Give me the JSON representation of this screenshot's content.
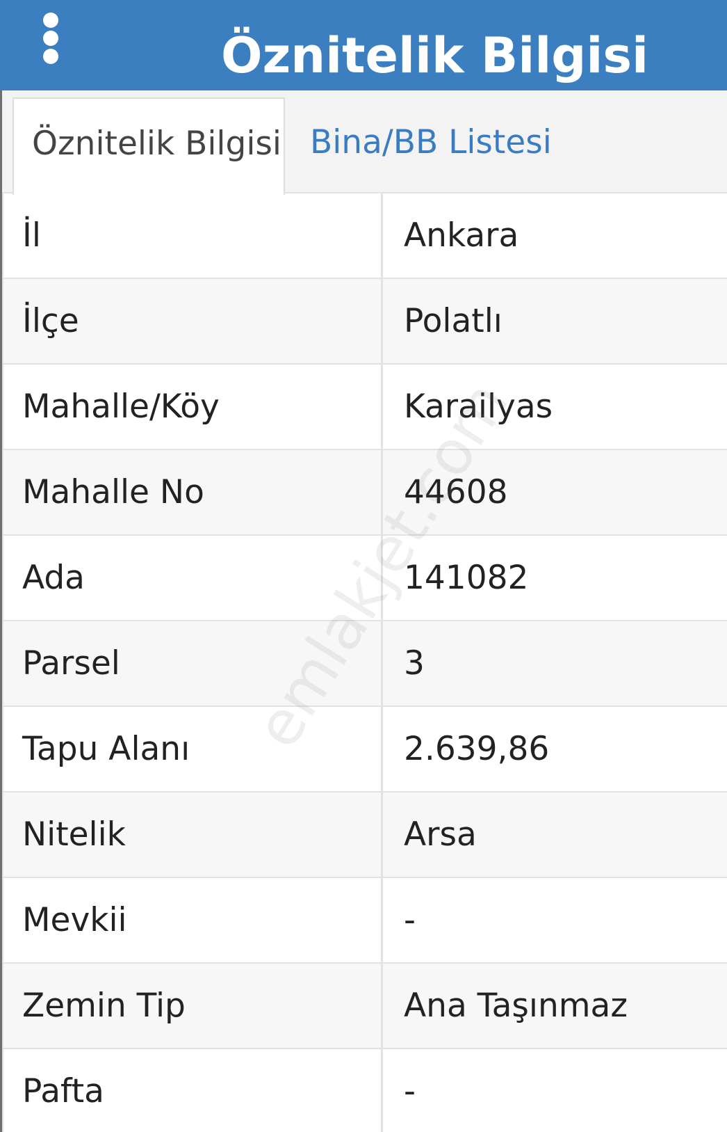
{
  "header": {
    "title": "Öznitelik Bilgisi",
    "menu_icon": "vertical-dots-icon",
    "background_color": "#3b7fc0"
  },
  "tabs": [
    {
      "label": "Öznitelik Bilgisi",
      "active": true
    },
    {
      "label": "Bina/BB Listesi",
      "active": false
    }
  ],
  "attributes": [
    {
      "key": "İl",
      "value": "Ankara"
    },
    {
      "key": "İlçe",
      "value": "Polatlı"
    },
    {
      "key": "Mahalle/Köy",
      "value": "Karailyas"
    },
    {
      "key": "Mahalle No",
      "value": "44608"
    },
    {
      "key": "Ada",
      "value": "141082"
    },
    {
      "key": "Parsel",
      "value": "3"
    },
    {
      "key": "Tapu Alanı",
      "value": "2.639,86"
    },
    {
      "key": "Nitelik",
      "value": "Arsa"
    },
    {
      "key": "Mevkii",
      "value": "-"
    },
    {
      "key": "Zemin Tip",
      "value": "Ana Taşınmaz"
    },
    {
      "key": "Pafta",
      "value": "-"
    }
  ],
  "watermark": "emlakjet.com",
  "colors": {
    "accent": "#3b7fc0",
    "tab_link": "#3a7cc1"
  }
}
